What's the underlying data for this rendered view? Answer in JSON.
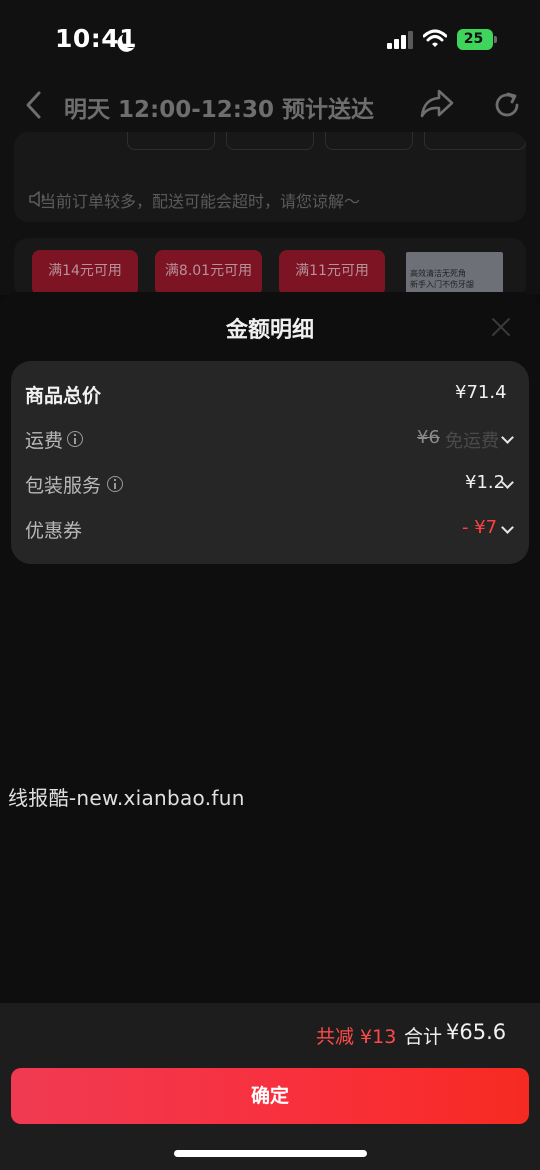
{
  "status_bar": {
    "time": "10:41",
    "battery": "25"
  },
  "background": {
    "nav_title": "明天 12:00-12:30 预计送达",
    "notice": "当前订单较多，配送可能会超时，请您谅解～",
    "coupons": [
      {
        "label": "满14元可用"
      },
      {
        "label": "满8.01元可用"
      },
      {
        "label": "满11元可用"
      }
    ],
    "ad_text": [
      "高效清洁无死角",
      "新手入门不伤牙龈"
    ]
  },
  "sheet": {
    "title": "金额明细",
    "rows": [
      {
        "label": "商品总价",
        "value": "¥71.4"
      },
      {
        "label": "运费",
        "value": "¥6",
        "note": "免运费"
      },
      {
        "label": "包装服务",
        "value": "¥1.2"
      },
      {
        "label": "优惠券",
        "value": "- ¥7"
      }
    ]
  },
  "watermark": "线报酷-new.xianbao.fun",
  "footer": {
    "saved": "共减 ¥13",
    "total_label": "合计",
    "total_value": "¥65.6",
    "confirm_label": "确定"
  },
  "colors": {
    "accent_red": "#ff4040",
    "button_gradient_start": "#f03a52",
    "button_gradient_end": "#f72a22",
    "battery_green": "#3fd55c"
  }
}
